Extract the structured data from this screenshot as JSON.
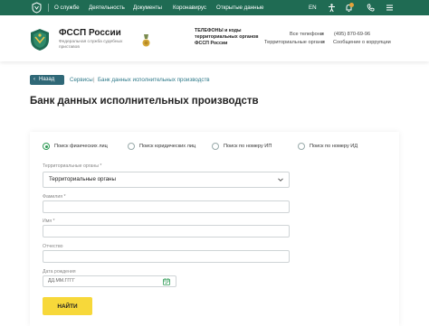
{
  "topbar": {
    "nav": [
      "О службе",
      "Деятельность",
      "Документы",
      "Коронавирус",
      "Открытые данные"
    ],
    "lang": "EN",
    "icons": [
      "fssp-logo-icon",
      "accessibility-icon",
      "bell-icon",
      "phone-icon",
      "menu-icon"
    ]
  },
  "header": {
    "brand_title": "ФССП России",
    "brand_subtitle": "Федеральная служба судебных приставов",
    "phones_title": "ТЕЛЕФОНЫ и коды территориальных органов ФССП России",
    "all_phones": "Все телефоны",
    "territorial": "Территориальные органы",
    "phone_number": "(495) 870-69-96",
    "corruption": "Сообщение о коррупции"
  },
  "breadcrumb": {
    "back": "Назад",
    "items": [
      "Сервисы",
      "Банк данных исполнительных производств"
    ]
  },
  "page_title": "Банк данных исполнительных производств",
  "search_types": [
    {
      "label": "Поиск физических лиц",
      "checked": true
    },
    {
      "label": "Поиск юридических лиц",
      "checked": false
    },
    {
      "label": "Поиск по номеру ИП",
      "checked": false
    },
    {
      "label": "Поиск по номеру ИД",
      "checked": false
    }
  ],
  "form": {
    "territorial_label": "Территориальные органы *",
    "territorial_value": "Территориальные органы",
    "surname_label": "Фамилия *",
    "name_label": "Имя *",
    "patronymic_label": "Отчество",
    "birthdate_label": "Дата рождения",
    "birthdate_placeholder": "ДД.ММ.ГГГГ",
    "submit": "НАЙТИ"
  },
  "colors": {
    "brand_green": "#1f6b53",
    "button_yellow": "#f7d83a",
    "radio_green": "#2e9a55",
    "back_button": "#2f6877"
  }
}
